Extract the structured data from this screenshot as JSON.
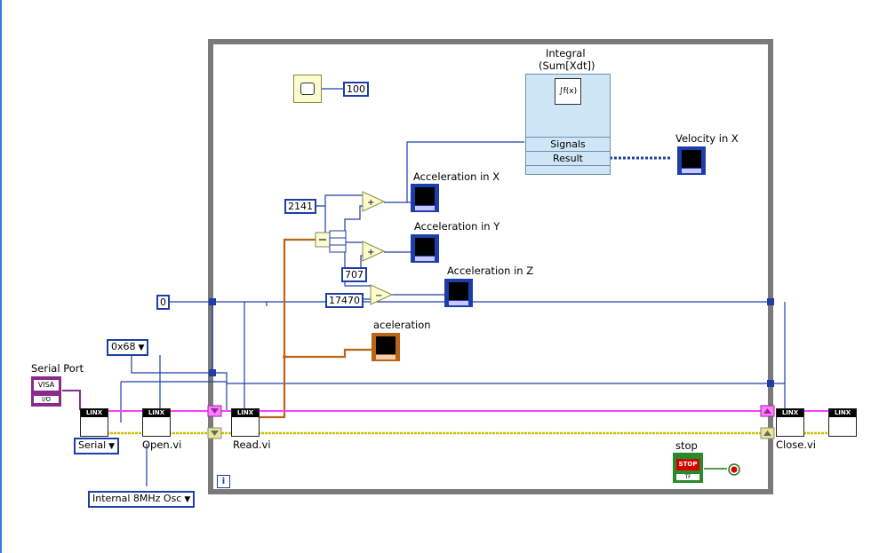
{
  "left_edge_color": "#3c78d8",
  "loop": {
    "info_icon_label": "i"
  },
  "wait": {
    "ms": "100"
  },
  "constants": {
    "c2141": "2141",
    "c707": "707",
    "c17470": "17470",
    "zero": "0"
  },
  "rings": {
    "address": "0x68",
    "interface": "Serial",
    "clock": "Internal 8MHz Osc"
  },
  "labels": {
    "serial_port": "Serial Port",
    "visa": "VISA",
    "visa_io": "I/O",
    "open": "Open.vi",
    "read": "Read.vi",
    "close": "Close.vi",
    "acc_x": "Acceleration in X",
    "acc_y": "Acceleration in Y",
    "acc_z": "Acceleration in Z",
    "acceleration": "aceleration",
    "velocity": "Velocity in X",
    "stop": "stop",
    "stop_button": "STOP",
    "stop_tf": "TF"
  },
  "integral": {
    "title_line1": "Integral",
    "title_line2": "(Sum[Xdt])",
    "icon": "∫f(x)",
    "signals": "Signals",
    "result": "Result"
  },
  "vi_header": "LINX",
  "icons": {
    "wait": "wait-timer-icon",
    "linx": "linx-subvi-icon",
    "graph": "graph-indicator-icon"
  },
  "colors": {
    "numeric_wire": "#1d3ea8",
    "cluster_wire": "#b8651a",
    "visa_wire": "#8a2a8a",
    "error_wire": "#d8d800",
    "pink_wire": "#ff40ff",
    "loop_border": "#787878",
    "express_vi": "#cfe6f7"
  }
}
